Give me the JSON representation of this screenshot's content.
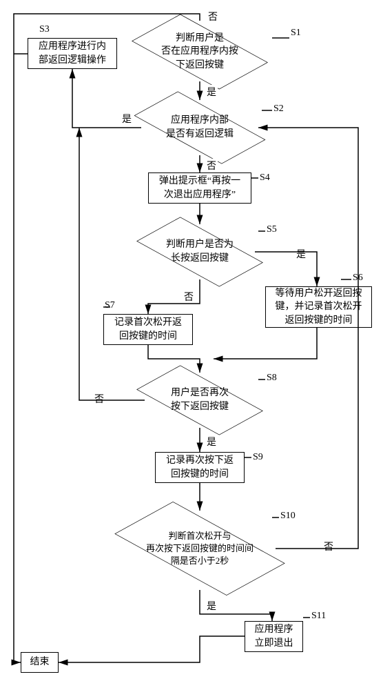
{
  "labels": {
    "s1": "S1",
    "s2": "S2",
    "s3": "S3",
    "s4": "S4",
    "s5": "S5",
    "s6": "S6",
    "s7": "S7",
    "s8": "S8",
    "s9": "S9",
    "s10": "S10",
    "s11": "S11"
  },
  "edges": {
    "yes": "是",
    "no": "否"
  },
  "nodes": {
    "s1": "判断用户是\n否在应用程序内按\n下返回按键",
    "s2": "应用程序内部\n是否有返回逻辑",
    "s3": "应用程序进行内\n部返回逻辑操作",
    "s4": "弹出提示框“再按一\n次退出应用程序”",
    "s5": "判断用户是否为\n长按返回按键",
    "s6": "等待用户松开返回按\n键，并记录首次松开\n返回按键的时间",
    "s7": "记录首次松开返\n回按键的时间",
    "s8": "用户是否再次\n按下返回按键",
    "s9": "记录再次按下返\n回按键的时间",
    "s10": "判断首次松开与\n再次按下返回按键的时间间\n隔是否小于2秒",
    "s11": "应用程序\n立即退出",
    "end": "结束"
  },
  "chart_data": {
    "type": "flowchart",
    "nodes": [
      {
        "id": "S1",
        "type": "decision",
        "text": "判断用户是否在应用程序内按下返回按键"
      },
      {
        "id": "S2",
        "type": "decision",
        "text": "应用程序内部是否有返回逻辑"
      },
      {
        "id": "S3",
        "type": "process",
        "text": "应用程序进行内部返回逻辑操作"
      },
      {
        "id": "S4",
        "type": "process",
        "text": "弹出提示框“再按一次退出应用程序”"
      },
      {
        "id": "S5",
        "type": "decision",
        "text": "判断用户是否为长按返回按键"
      },
      {
        "id": "S6",
        "type": "process",
        "text": "等待用户松开返回按键，并记录首次松开返回按键的时间"
      },
      {
        "id": "S7",
        "type": "process",
        "text": "记录首次松开返回按键的时间"
      },
      {
        "id": "S8",
        "type": "decision",
        "text": "用户是否再次按下返回按键"
      },
      {
        "id": "S9",
        "type": "process",
        "text": "记录再次按下返回按键的时间"
      },
      {
        "id": "S10",
        "type": "decision",
        "text": "判断首次松开与再次按下返回按键的时间间隔是否小于2秒"
      },
      {
        "id": "S11",
        "type": "process",
        "text": "应用程序立即退出"
      },
      {
        "id": "end",
        "type": "terminator",
        "text": "结束"
      }
    ],
    "edges": [
      {
        "from": "S1",
        "to": "S2",
        "label": "是"
      },
      {
        "from": "S1",
        "to": "end",
        "label": "否",
        "route": "left-down"
      },
      {
        "from": "S2",
        "to": "S3",
        "label": "是"
      },
      {
        "from": "S2",
        "to": "S4",
        "label": "否"
      },
      {
        "from": "S4",
        "to": "S5"
      },
      {
        "from": "S5",
        "to": "S6",
        "label": "是"
      },
      {
        "from": "S5",
        "to": "S7",
        "label": "否"
      },
      {
        "from": "S6",
        "to": "S8"
      },
      {
        "from": "S7",
        "to": "S8"
      },
      {
        "from": "S8",
        "to": "S9",
        "label": "是"
      },
      {
        "from": "S8",
        "to": "S2",
        "label": "否",
        "route": "right-up"
      },
      {
        "from": "S9",
        "to": "S10"
      },
      {
        "from": "S10",
        "to": "S11",
        "label": "是"
      },
      {
        "from": "S10",
        "to": "S2",
        "label": "否",
        "route": "right-up"
      },
      {
        "from": "S3",
        "to": "end",
        "route": "left-down"
      },
      {
        "from": "S11",
        "to": "end"
      }
    ]
  }
}
